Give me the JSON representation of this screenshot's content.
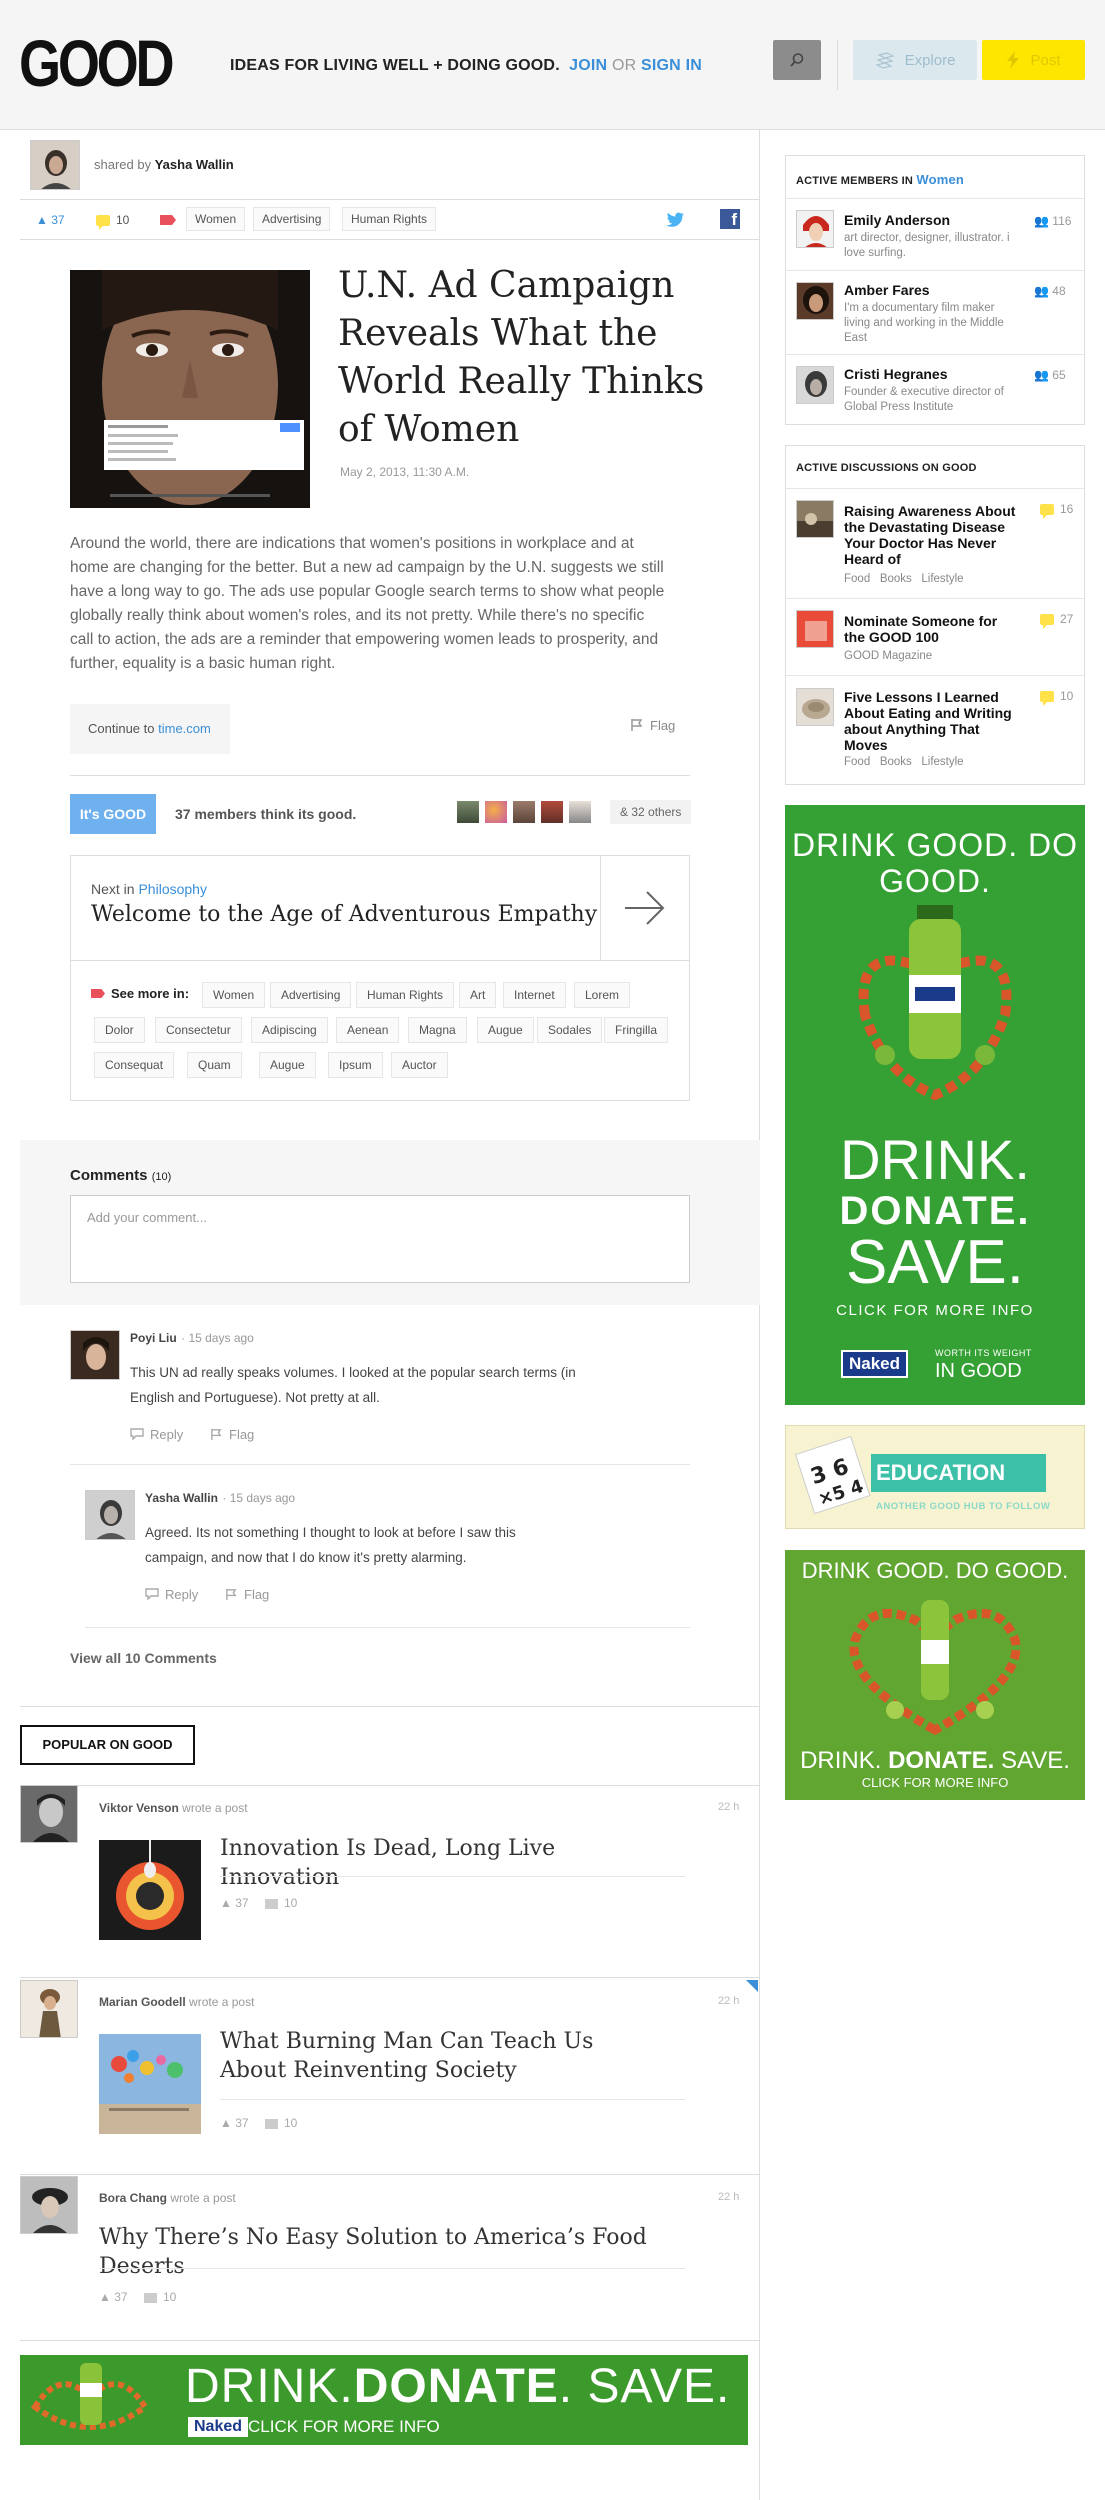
{
  "header": {
    "logo": "GOOD",
    "tagline": "IDEAS FOR LIVING WELL + DOING GOOD.",
    "join": "JOIN",
    "or": "OR",
    "signin": "SIGN IN",
    "explore": "Explore",
    "post": "Post"
  },
  "shared": {
    "prefix": "shared by",
    "name": "Yasha Wallin"
  },
  "tags_row": {
    "likes": "37",
    "comments": "10",
    "tags": [
      "Women",
      "Advertising",
      "Human Rights"
    ]
  },
  "article": {
    "title": "U.N. Ad Campaign Reveals What the World Really Thinks of Women",
    "date": "May 2, 2013, 11:30 A.M.",
    "body": "Around the world, there are indications that women's positions in workplace and at home are changing for the better. But a new ad campaign by the U.N. suggests we still have a long way to go. The ads use popular Google search terms to show what people globally really think about women's roles, and its not pretty. While there's no specific call to action, the ads are a reminder that empowering women leads to prosperity, and further, equality is a basic human right.",
    "continue_prefix": "Continue to",
    "continue_link": "time.com",
    "flag": "Flag"
  },
  "good": {
    "button": "It's GOOD",
    "members": "37 members think its good.",
    "others": "& 32 others"
  },
  "next": {
    "prefix": "Next in",
    "category": "Philosophy",
    "title": "Welcome to the Age of Adventurous Empathy"
  },
  "see_more": {
    "label": "See more in:",
    "row1": [
      "Women",
      "Advertising",
      "Human Rights",
      "Art",
      "Internet",
      "Lorem"
    ],
    "row2": [
      "Dolor",
      "Consectetur",
      "Adipiscing",
      "Aenean",
      "Magna",
      "Augue",
      "Sodales",
      "Fringilla"
    ],
    "row3": [
      "Consequat",
      "Quam",
      "Augue",
      "Ipsum",
      "Auctor"
    ]
  },
  "comments": {
    "heading": "Comments",
    "count": "(10)",
    "placeholder": "Add your comment...",
    "items": [
      {
        "name": "Poyi Liu",
        "time": "· 15 days ago",
        "text": "This UN ad really speaks volumes. I looked at the popular search terms (in English and Portuguese). Not pretty at all.",
        "reply": "Reply",
        "flag": "Flag"
      },
      {
        "name": "Yasha Wallin",
        "time": "· 15 days ago",
        "text": "Agreed. Its not something I thought to look at before I saw this campaign, and now that I do know it's pretty alarming.",
        "reply": "Reply",
        "flag": "Flag"
      }
    ],
    "view_all": "View all 10 Comments"
  },
  "popular": {
    "label": "POPULAR ON GOOD",
    "items": [
      {
        "author": "Viktor Venson",
        "action": "wrote a post",
        "time": "22 h",
        "title": "Innovation Is Dead, Long Live Innovation",
        "likes": "37",
        "comments": "10"
      },
      {
        "author": "Marian Goodell",
        "action": "wrote a post",
        "time": "22 h",
        "title": "What Burning Man Can Teach Us About Reinventing Society",
        "likes": "37",
        "comments": "10"
      },
      {
        "author": "Bora Chang",
        "action": "wrote a post",
        "time": "22 h",
        "title": "Why There’s No Easy Solution to America’s Food Deserts",
        "likes": "37",
        "comments": "10"
      }
    ]
  },
  "sidebar": {
    "members_heading": "ACTIVE MEMBERS IN",
    "members_topic": "Women",
    "members": [
      {
        "name": "Emily Anderson",
        "desc": "art director, designer, illustrator. i love surfing.",
        "count": "116"
      },
      {
        "name": "Amber Fares",
        "desc": "I'm a documentary film maker living and working in the Middle East",
        "count": "48"
      },
      {
        "name": "Cristi Hegranes",
        "desc": "Founder & executive director of Global Press Institute",
        "count": "65"
      }
    ],
    "discussions_heading": "ACTIVE DISCUSSIONS ON GOOD",
    "discussions": [
      {
        "title": "Raising Awareness About the Devastating Disease Your Doctor Has Never Heard of",
        "tags": [
          "Food",
          "Books",
          "Lifestyle"
        ],
        "count": "16"
      },
      {
        "title": "Nominate Someone for the GOOD 100",
        "tags": [
          "GOOD Magazine"
        ],
        "count": "27"
      },
      {
        "title": "Five Lessons I Learned About Eating and Writing about Anything That Moves",
        "tags": [
          "Food",
          "Books",
          "Lifestyle"
        ],
        "count": "10"
      }
    ]
  },
  "ads": {
    "ad1_top": "DRINK GOOD. DO GOOD.",
    "ad1_drink": "DRINK.",
    "ad1_donate": "DONATE.",
    "ad1_save": "SAVE.",
    "ad1_click": "CLICK FOR MORE INFO",
    "brand": "Naked",
    "ad1_worth": "WORTH ITS WEIGHT",
    "ad1_ingood": "IN GOOD",
    "edu_title": "EDUCATION",
    "edu_sub": "ANOTHER GOOD HUB TO FOLLOW",
    "ad2_top": "DRINK GOOD. DO GOOD.",
    "ad2_bottom_a": "DRINK.",
    "ad2_bottom_b": "DONATE.",
    "ad2_bottom_c": "SAVE.",
    "ad2_click": "CLICK FOR MORE INFO",
    "banner_a": "DRINK.",
    "banner_b": "DONATE",
    "banner_c": ". SAVE.",
    "banner_click": "CLICK FOR MORE INFO"
  },
  "colors": {
    "accent_blue": "#3a8fd8",
    "good_blue": "#6fb0ef",
    "post_yellow": "#ffe600",
    "ad_green": "#2fa02f"
  }
}
